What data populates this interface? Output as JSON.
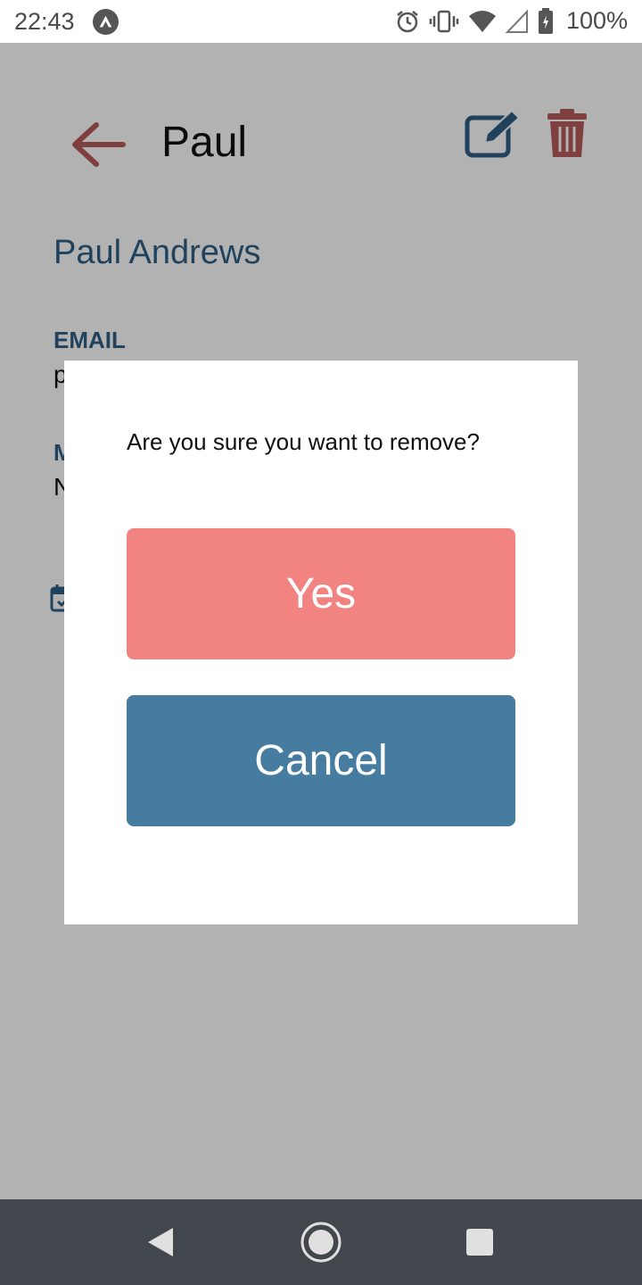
{
  "status_bar": {
    "time": "22:43",
    "battery": "100%",
    "icons": [
      "app-notification-icon",
      "alarm-icon",
      "vibrate-icon",
      "wifi-icon",
      "cell-signal-icon",
      "battery-icon"
    ]
  },
  "header": {
    "title": "Paul",
    "back_icon": "arrow-left-icon",
    "edit_icon": "edit-icon",
    "delete_icon": "trash-icon"
  },
  "contact": {
    "full_name": "Paul Andrews",
    "email_label": "EMAIL",
    "email_partial": "p",
    "second_label_partial": "M",
    "second_value_partial": "N",
    "calendar_icon": "calendar-check-icon"
  },
  "dialog": {
    "message": "Are you sure you want to remove?",
    "yes_label": "Yes",
    "cancel_label": "Cancel"
  },
  "colors": {
    "accent_blue": "#467ca0",
    "accent_red": "#f18480",
    "icon_red": "#b85b5b",
    "text_blue": "#2f5f85",
    "nav_bar": "#42474d"
  }
}
